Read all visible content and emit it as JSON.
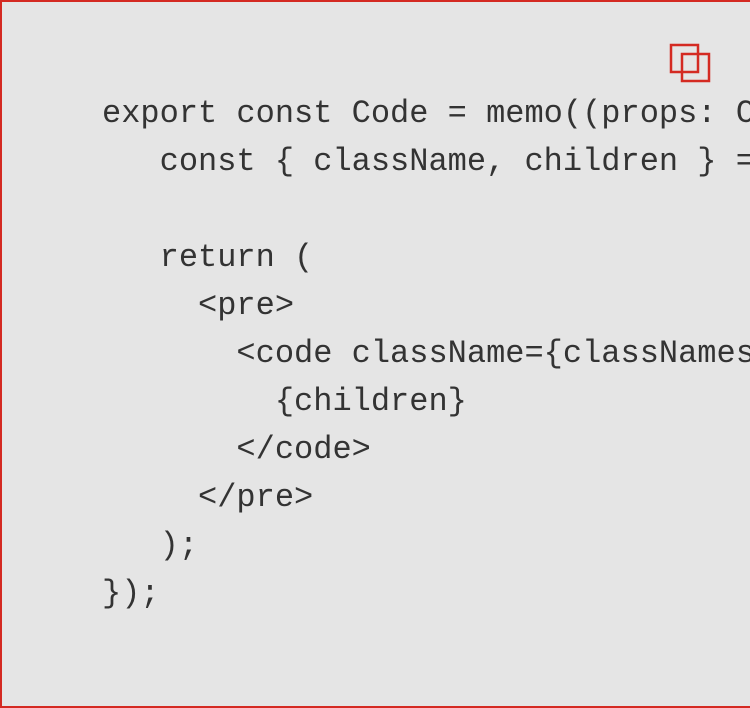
{
  "code_block": {
    "copy_icon": "copy-icon",
    "lines": [
      "export const Code = memo((props: C",
      "   const { className, children } =",
      "",
      "   return (",
      "     <pre>",
      "       <code className={classNames",
      "         {children}",
      "       </code>",
      "     </pre>",
      "   );",
      "});"
    ]
  },
  "colors": {
    "background": "#e5e5e5",
    "border": "#d42a22",
    "icon": "#d42a22",
    "text": "#333333"
  }
}
